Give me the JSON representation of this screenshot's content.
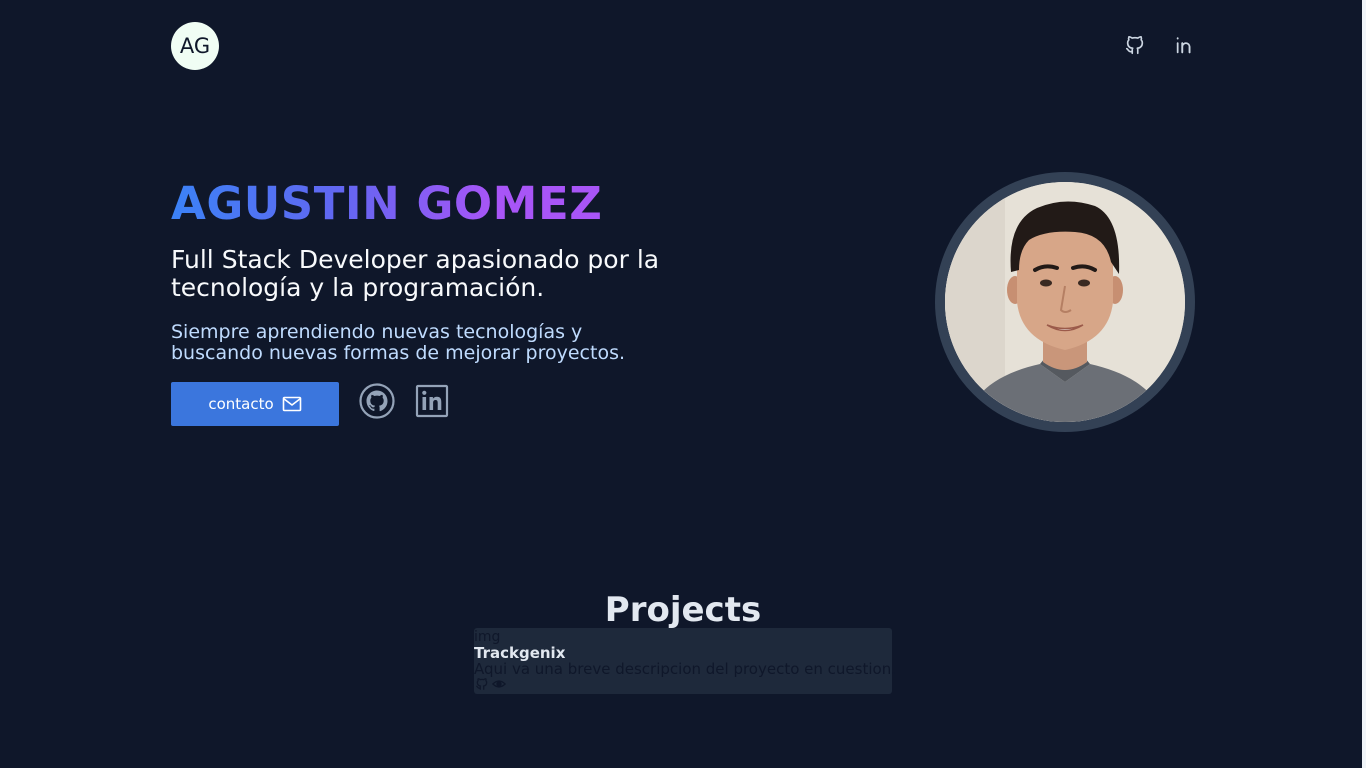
{
  "header": {
    "logo_text": "AG",
    "nav_icons": [
      "github-icon",
      "linkedin-icon"
    ]
  },
  "hero": {
    "name": "AGUSTIN GOMEZ",
    "tagline": "Full Stack Developer apasionado por la tecnología y la programación.",
    "subtitle": "Siempre aprendiendo nuevas tecnologías y buscando nuevas formas de mejorar proyectos.",
    "contact_label": "contacto",
    "contact_icon": "mail-icon",
    "social_icons": [
      "github-icon",
      "linkedin-icon"
    ],
    "name_gradient": [
      "#3b82f6",
      "#a855f7"
    ]
  },
  "projects": {
    "title": "Projects",
    "items": [
      {
        "image_alt": "img",
        "name": "Trackgenix",
        "description": "Aqui va una breve descripcion del proyecto en cuestion.",
        "icons": [
          "github-icon",
          "eye-icon"
        ]
      }
    ]
  },
  "colors": {
    "background": "#0f172a",
    "card": "#1e293b",
    "button": "#3b76dd",
    "avatar_ring": "#334155"
  }
}
